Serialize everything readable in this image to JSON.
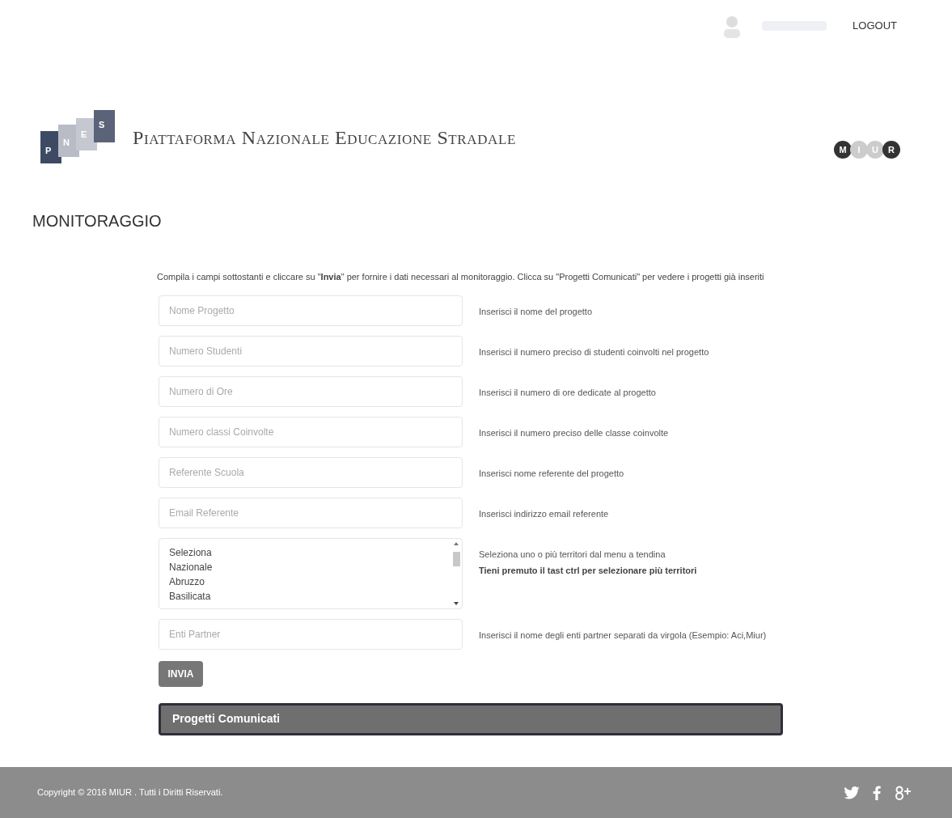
{
  "header": {
    "logout": "LOGOUT",
    "logo_letters": [
      "P",
      "N",
      "E",
      "S"
    ],
    "site_title": "Piattaforma Nazionale Educazione Stradale",
    "ministry_logo_letters": [
      "M",
      "I",
      "U",
      "R"
    ]
  },
  "page_title": "MONITORAGGIO",
  "form": {
    "intro": "Compila i campi sottostanti e cliccare su \"**Invia**\" per fornire i dati necessari al monitoraggio. Clicca su \"Progetti Comunicati\" per vedere i progetti già inseriti",
    "fields": [
      {
        "kind": "input",
        "placeholder": "Nome Progetto",
        "help": "Inserisci il nome del progetto"
      },
      {
        "kind": "input",
        "placeholder": "Numero Studenti",
        "help": "Inserisci il numero preciso di studenti coinvolti nel progetto"
      },
      {
        "kind": "input",
        "placeholder": "Numero di Ore",
        "help": "Inserisci il numero di ore dedicate al progetto"
      },
      {
        "kind": "input",
        "placeholder": "Numero classi Coinvolte",
        "help": "Inserisci il numero preciso delle classe coinvolte"
      },
      {
        "kind": "input",
        "placeholder": "Referente Scuola",
        "help": "Inserisci nome referente del progetto"
      },
      {
        "kind": "input",
        "placeholder": "Email Referente",
        "help": "Inserisci indirizzo email referente"
      },
      {
        "kind": "select",
        "options": [
          "Seleziona",
          "Nazionale",
          "Abruzzo",
          "Basilicata"
        ],
        "help": "Seleziona uno o più territori dal menu a tendina",
        "help_bold": "Tieni premuto il tast ctrl per selezionare più territori"
      },
      {
        "kind": "input",
        "placeholder": "Enti Partner",
        "help": "Inserisci il nome degli enti partner separati da virgola (Esempio: Aci,Miur)"
      }
    ],
    "submit": "INVIA"
  },
  "projects_bar": "Progetti Comunicati",
  "footer": {
    "copyright": "Copyright © 2016 MIUR . Tutti i Diritti Riservati."
  }
}
